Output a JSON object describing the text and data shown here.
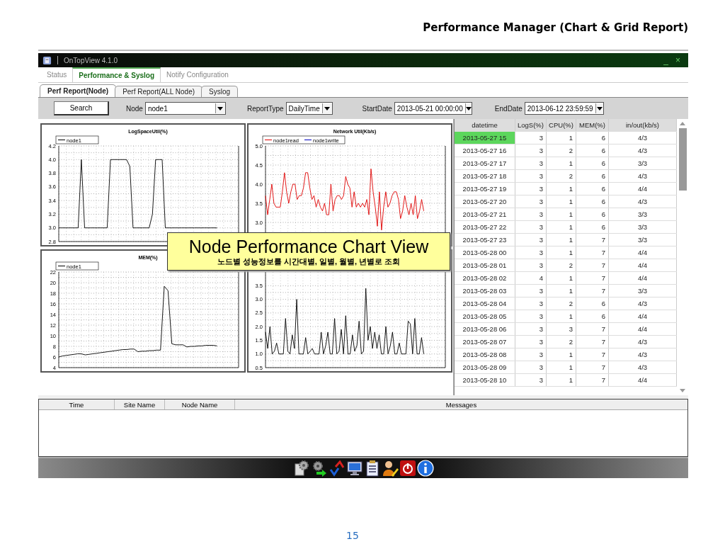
{
  "slide": {
    "title": "Performance Manager (Chart & Grid Report)",
    "page_number": "15"
  },
  "window": {
    "title": "OnTopView 4.1.0",
    "minimize": "_",
    "close": "×"
  },
  "tabs": [
    {
      "label": "Status",
      "selected": false
    },
    {
      "label": "Performance & Syslog",
      "selected": true
    },
    {
      "label": "Notify Configuration",
      "selected": false
    }
  ],
  "sub_tabs": [
    {
      "label": "Perf Report(Node)",
      "selected": true
    },
    {
      "label": "Perf Report(ALL Node)",
      "selected": false
    },
    {
      "label": "Syslog",
      "selected": false
    }
  ],
  "toolbar": {
    "search_button": "Search",
    "fields": [
      {
        "label": "Node",
        "value": "node1"
      },
      {
        "label": "ReportType",
        "value": "DailyTime"
      },
      {
        "label": "StartDate",
        "value": "2013-05-21 00:00:00"
      },
      {
        "label": "EndDate",
        "value": "2013-06-12 23:59:59"
      }
    ]
  },
  "charts": [
    {
      "chart_data": {
        "type": "line",
        "title": "LogSpaceUtil(%)",
        "grid": true,
        "ylim": [
          2.8,
          4.2
        ],
        "yticks": [
          {
            "value": 2.8,
            "label": "2.8"
          },
          {
            "value": 3.0,
            "label": "3.0"
          },
          {
            "value": 3.2,
            "label": "3.2"
          },
          {
            "value": 3.4,
            "label": "3.4"
          },
          {
            "value": 3.6,
            "label": "3.6"
          },
          {
            "value": 3.8,
            "label": "3.8"
          },
          {
            "value": 4.0,
            "label": "4.0"
          },
          {
            "value": 4.2,
            "label": "4.2"
          }
        ],
        "series": [
          {
            "name": "node1",
            "color": "#000000",
            "values": [
              3,
              3,
              3,
              3,
              3,
              3,
              3,
              4,
              3,
              3,
              3,
              3,
              3,
              3,
              3,
              3,
              4,
              4,
              4,
              4,
              4,
              4,
              3.9,
              3,
              3,
              3,
              3,
              3,
              3,
              3.2,
              4,
              4,
              4,
              3,
              3,
              3,
              3,
              3,
              3,
              3,
              3,
              3,
              3,
              3,
              3,
              3,
              3,
              3,
              3,
              3
            ]
          }
        ]
      }
    },
    {
      "chart_data": {
        "type": "line",
        "title": "Network Util(Kb/s)",
        "grid": true,
        "ylim": [
          2.5,
          5.0
        ],
        "yticks": [
          {
            "value": 3.0,
            "label": "3.0"
          },
          {
            "value": 3.5,
            "label": "3.5"
          },
          {
            "value": 4.0,
            "label": "4.0"
          },
          {
            "value": 4.5,
            "label": "4.5"
          },
          {
            "value": 5.0,
            "label": "5.0"
          }
        ],
        "series": [
          {
            "name": "node1read",
            "color": "#e00000",
            "values": [
              3.7,
              3.2,
              3.6,
              4.0,
              3.5,
              3.4,
              3.4,
              3.4,
              3.8,
              4.3,
              3.8,
              3.5,
              3.8,
              4.0,
              4.0,
              3.6,
              3.7,
              3.7,
              3.9,
              4.3,
              4.3,
              3.9,
              3.6,
              3.7,
              3.4,
              3.6,
              3.4,
              3.3,
              3.5,
              3.2,
              3.2,
              4.0,
              3.3,
              3.6,
              3.7,
              3.7,
              3.6,
              3.7,
              4.2,
              4.0,
              3.9,
              3.4,
              3.8,
              3.4,
              3.5,
              3.4,
              3.5,
              3.4,
              3.6,
              3.2,
              4.4,
              3.8,
              3.4,
              2.9,
              3.8,
              2.8,
              3.4,
              3.8,
              3.4,
              3.5,
              3.7,
              3.8,
              3.8,
              3.6,
              3.1,
              3.3,
              3.7,
              3.4,
              3.2,
              3.5,
              3.2,
              3.7,
              3.1,
              3.3,
              3.6,
              3.3
            ]
          },
          {
            "name": "node1write",
            "color": "#0000c0",
            "values": [
              null
            ]
          }
        ]
      }
    },
    {
      "chart_data": {
        "type": "line",
        "title": "MEM(%)",
        "grid": true,
        "ylim": [
          4,
          22
        ],
        "yticks": [
          {
            "value": 4,
            "label": "4"
          },
          {
            "value": 6,
            "label": "6"
          },
          {
            "value": 8,
            "label": "8"
          },
          {
            "value": 10,
            "label": "10"
          },
          {
            "value": 12,
            "label": "12"
          },
          {
            "value": 14,
            "label": "14"
          },
          {
            "value": 16,
            "label": "16"
          },
          {
            "value": 18,
            "label": "18"
          },
          {
            "value": 20,
            "label": "20"
          },
          {
            "value": 22,
            "label": "22"
          }
        ],
        "series": [
          {
            "name": "node1",
            "color": "#000000",
            "values": [
              6.0,
              6.2,
              6.3,
              6.4,
              6.5,
              6.6,
              6.6,
              6.4,
              6.5,
              6.6,
              6.7,
              6.8,
              6.9,
              7.0,
              7.1,
              7.2,
              7.3,
              7.4,
              7.4,
              7.5,
              7.5,
              7.0,
              7.1,
              7.1,
              7.2,
              7.2,
              7.3,
              7.3,
              19.3,
              18.5,
              8.5,
              8.3,
              8.3,
              8.3,
              7.9,
              8.0,
              8.0,
              8.1,
              8.1,
              8.2,
              8.2,
              8.2,
              8.1
            ]
          }
        ]
      }
    },
    {
      "chart_data": {
        "type": "line",
        "grid": true,
        "ylim": [
          0.5,
          4.0
        ],
        "yticks": [
          {
            "value": 0.5,
            "label": "0.5"
          },
          {
            "value": 1.0,
            "label": "1.0"
          },
          {
            "value": 1.5,
            "label": "1.5"
          },
          {
            "value": 2.0,
            "label": "2.0"
          },
          {
            "value": 2.5,
            "label": "2.5"
          },
          {
            "value": 3.0,
            "label": "3.0"
          },
          {
            "value": 3.5,
            "label": "3.5"
          }
        ],
        "series": [
          {
            "color": "#000000",
            "values": [
              1.8,
              1.2,
              2.0,
              1.0,
              1.1,
              1.4,
              1.0,
              1.0,
              1.0,
              2.3,
              1.1,
              1.0,
              1.7,
              1.2,
              3.0,
              1.0,
              1.0,
              1.0,
              1.6,
              1.0,
              1.1,
              1.2,
              1.0,
              1.0,
              1.0,
              1.8,
              1.0,
              1.3,
              1.8,
              1.0,
              1.0,
              2.3,
              1.0,
              1.1,
              1.9,
              1.0,
              2.4,
              1.0,
              1.0,
              1.7,
              1.1,
              1.3,
              2.2,
              1.0,
              1.1,
              3.4,
              1.5,
              2.0,
              1.2,
              1.8,
              1.2,
              1.7,
              1.0,
              1.0,
              2.0,
              1.0,
              1.3,
              1.8,
              1.0,
              1.0,
              1.4,
              1.0,
              1.0,
              1.0,
              2.2,
              2.1,
              1.0,
              2.3,
              1.0,
              1.0,
              1.6,
              1.0
            ]
          }
        ]
      }
    }
  ],
  "callout": {
    "title": "Node Performance Chart View",
    "subtitle": "노드별 성능정보를 시간대별, 일별, 월별, 년별로 조회"
  },
  "grid": {
    "columns": [
      "datetime",
      "LogS(%)",
      "CPU(%)",
      "MEM(%)",
      "in/out(kb/s)"
    ],
    "rows": [
      {
        "selected": true,
        "cells": [
          "2013-05-27 15",
          "3",
          "1",
          "6",
          "4/3"
        ]
      },
      {
        "selected": false,
        "cells": [
          "2013-05-27 16",
          "3",
          "2",
          "6",
          "4/3"
        ]
      },
      {
        "selected": false,
        "cells": [
          "2013-05-27 17",
          "3",
          "1",
          "6",
          "3/3"
        ]
      },
      {
        "selected": false,
        "cells": [
          "2013-05-27 18",
          "3",
          "2",
          "6",
          "4/3"
        ]
      },
      {
        "selected": false,
        "cells": [
          "2013-05-27 19",
          "3",
          "1",
          "6",
          "4/4"
        ]
      },
      {
        "selected": false,
        "cells": [
          "2013-05-27 20",
          "3",
          "1",
          "6",
          "4/3"
        ]
      },
      {
        "selected": false,
        "cells": [
          "2013-05-27 21",
          "3",
          "1",
          "6",
          "3/3"
        ]
      },
      {
        "selected": false,
        "cells": [
          "2013-05-27 22",
          "3",
          "1",
          "6",
          "3/3"
        ]
      },
      {
        "selected": false,
        "cells": [
          "2013-05-27 23",
          "3",
          "1",
          "7",
          "3/3"
        ]
      },
      {
        "selected": false,
        "cells": [
          "2013-05-28 00",
          "3",
          "1",
          "7",
          "4/4"
        ]
      },
      {
        "selected": false,
        "cells": [
          "2013-05-28 01",
          "3",
          "2",
          "7",
          "4/4"
        ]
      },
      {
        "selected": false,
        "cells": [
          "2013-05-28 02",
          "4",
          "1",
          "7",
          "4/4"
        ]
      },
      {
        "selected": false,
        "cells": [
          "2013-05-28 03",
          "3",
          "1",
          "7",
          "3/3"
        ]
      },
      {
        "selected": false,
        "cells": [
          "2013-05-28 04",
          "3",
          "2",
          "6",
          "4/3"
        ]
      },
      {
        "selected": false,
        "cells": [
          "2013-05-28 05",
          "3",
          "1",
          "6",
          "4/4"
        ]
      },
      {
        "selected": false,
        "cells": [
          "2013-05-28 06",
          "3",
          "3",
          "7",
          "4/4"
        ]
      },
      {
        "selected": false,
        "cells": [
          "2013-05-28 07",
          "3",
          "2",
          "7",
          "4/3"
        ]
      },
      {
        "selected": false,
        "cells": [
          "2013-05-28 08",
          "3",
          "1",
          "7",
          "4/3"
        ]
      },
      {
        "selected": false,
        "cells": [
          "2013-05-28 09",
          "3",
          "1",
          "7",
          "4/3"
        ]
      },
      {
        "selected": false,
        "cells": [
          "2013-05-28 10",
          "3",
          "1",
          "7",
          "4/4"
        ]
      }
    ]
  },
  "log_table": {
    "columns": [
      "Time",
      "Site Name",
      "Node Name",
      "Messages"
    ]
  }
}
